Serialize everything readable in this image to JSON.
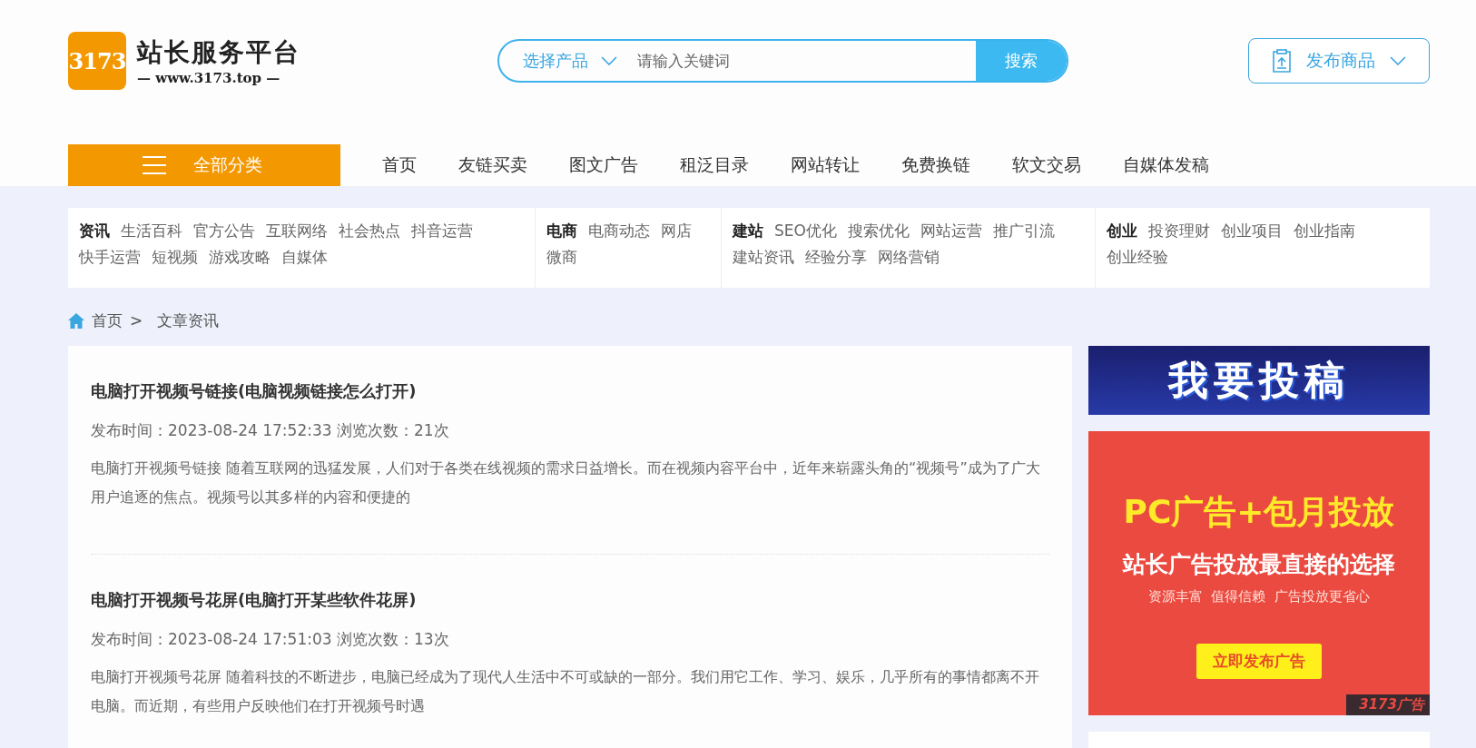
{
  "logo": {
    "badge": "3173",
    "name": "站长服务平台",
    "url": "— www.3173.top —"
  },
  "search": {
    "product_select": "选择产品",
    "placeholder": "请输入关键词",
    "button": "搜索"
  },
  "publish_button": {
    "label": "发布商品"
  },
  "nav": {
    "all_categories": "全部分类",
    "items": [
      "首页",
      "友链买卖",
      "图文广告",
      "租泛目录",
      "网站转让",
      "免费换链",
      "软文交易",
      "自媒体发稿"
    ]
  },
  "categories": [
    {
      "title": "资讯",
      "links": [
        "生活百科",
        "官方公告",
        "互联网络",
        "社会热点",
        "抖音运营",
        "快手运营",
        "短视频",
        "游戏攻略",
        "自媒体"
      ]
    },
    {
      "title": "电商",
      "links": [
        "电商动态",
        "网店",
        "微商"
      ]
    },
    {
      "title": "建站",
      "links": [
        "SEO优化",
        "搜索优化",
        "网站运营",
        "推广引流",
        "建站资讯",
        "经验分享",
        "网络营销"
      ]
    },
    {
      "title": "创业",
      "links": [
        "投资理财",
        "创业项目",
        "创业指南",
        "创业经验"
      ]
    }
  ],
  "breadcrumb": {
    "home": "首页",
    "separator": ">",
    "current": "文章资讯"
  },
  "articles": [
    {
      "title": "电脑打开视频号链接(电脑视频链接怎么打开)",
      "meta": "发布时间：2023-08-24 17:52:33 浏览次数：21次",
      "excerpt": "电脑打开视频号链接 随着互联网的迅猛发展，人们对于各类在线视频的需求日益增长。而在视频内容平台中，近年来崭露头角的“视频号”成为了广大用户追逐的焦点。视频号以其多样的内容和便捷的"
    },
    {
      "title": "电脑打开视频号花屏(电脑打开某些软件花屏)",
      "meta": "发布时间：2023-08-24 17:51:03 浏览次数：13次",
      "excerpt": "电脑打开视频号花屏 随着科技的不断进步，电脑已经成为了现代人生活中不可或缺的一部分。我们用它工作、学习、娱乐，几乎所有的事情都离不开电脑。而近期，有些用户反映他们在打开视频号时遇"
    }
  ],
  "banners": [
    {
      "kind": "submit",
      "text": "我要投稿"
    },
    {
      "kind": "ad",
      "headline": "PC广告+包月投放",
      "subhead": "站长广告投放最直接的选择",
      "tagline": "资源丰富  值得信赖  广告投放更省心",
      "button": "立即发布广告",
      "corner": "3173广告"
    },
    {
      "kind": "blank"
    }
  ]
}
